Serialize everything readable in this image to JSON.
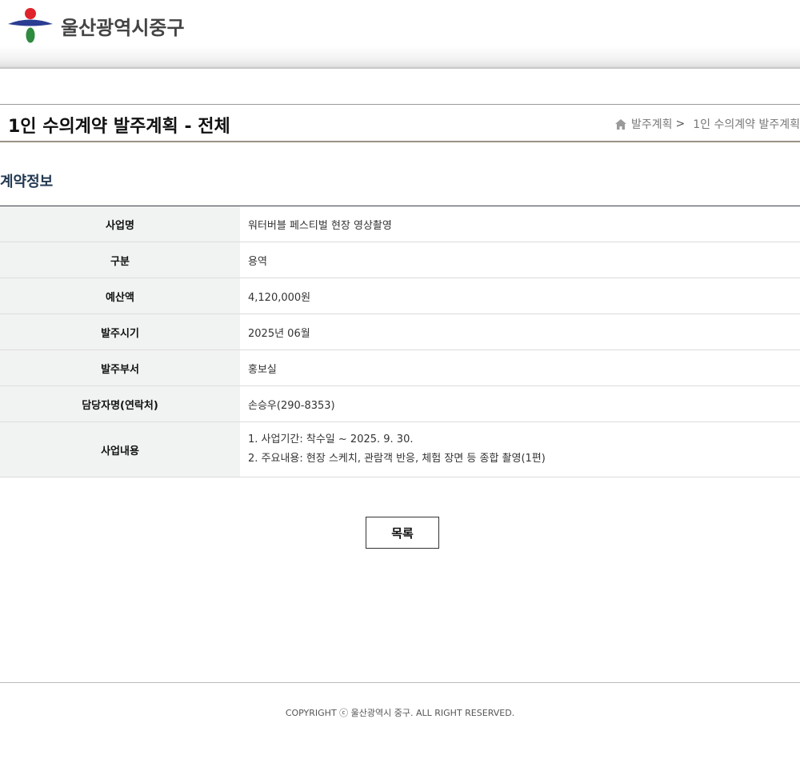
{
  "header": {
    "logo_text": "울산광역시중구",
    "colors": {
      "emblem_red": "#e0232b",
      "emblem_blue": "#2a3d93",
      "emblem_green": "#2e8b3f"
    }
  },
  "title_bar": {
    "title": "1인 수의계약 발주계획 - 전체",
    "breadcrumb": {
      "home_icon": "home-icon",
      "item1": "발주계획",
      "separator": ">",
      "item2": "1인 수의계약 발주계획"
    }
  },
  "section": {
    "title": "계약정보"
  },
  "info_rows": [
    {
      "label": "사업명",
      "value": "워터버블 페스티벌 현장 영상촬영"
    },
    {
      "label": "구분",
      "value": "용역"
    },
    {
      "label": "예산액",
      "value": "4,120,000원"
    },
    {
      "label": "발주시기",
      "value": "2025년 06월"
    },
    {
      "label": "발주부서",
      "value": "홍보실"
    },
    {
      "label": "담당자명(연락처)",
      "value": "손승우(290-8353)"
    },
    {
      "label": "사업내용",
      "lines": [
        "1. 사업기간: 착수일 ~ 2025. 9. 30.",
        "2. 주요내용: 현장 스케치, 관람객 반응, 체험 장면 등 종합 촬영(1편)"
      ]
    }
  ],
  "buttons": {
    "list_label": "목록"
  },
  "footer": {
    "copyright": "COPYRIGHT ⓒ 울산광역시 중구. ALL RIGHT RESERVED."
  }
}
